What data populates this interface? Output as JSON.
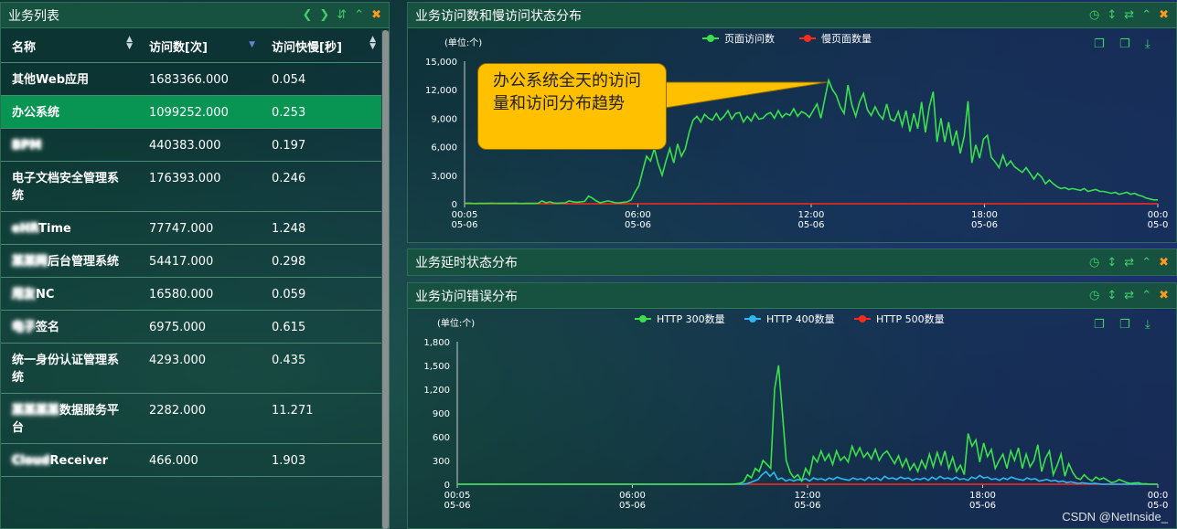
{
  "list_panel": {
    "title": "业务列表",
    "columns": [
      "名称",
      "访问数[次]",
      "访问快慢[秒]"
    ],
    "rows": [
      {
        "name": "其他Web应用",
        "visits": "1683366.000",
        "speed": "0.054",
        "masked": false
      },
      {
        "name": "办公系统",
        "visits": "1099252.000",
        "speed": "0.253",
        "masked": false,
        "selected": true
      },
      {
        "name": "BPM",
        "visits": "440383.000",
        "speed": "0.197",
        "masked": true
      },
      {
        "name": "电子文档安全管理系统",
        "visits": "176393.000",
        "speed": "0.246",
        "masked": false
      },
      {
        "name": "Time",
        "visits": "77747.000",
        "speed": "1.248",
        "masked": false,
        "prefix_masked": "eHR"
      },
      {
        "name": "后台管理系统",
        "visits": "54417.000",
        "speed": "0.298",
        "masked": false,
        "prefix_masked": "某某网"
      },
      {
        "name": "NC",
        "visits": "16580.000",
        "speed": "0.059",
        "masked": false,
        "prefix_masked": "用友"
      },
      {
        "name": "签名",
        "visits": "6975.000",
        "speed": "0.615",
        "masked": false,
        "prefix_masked": "电子"
      },
      {
        "name": "统一身份认证管理系统",
        "visits": "4293.000",
        "speed": "0.435",
        "masked": false
      },
      {
        "name": "数据服务平台",
        "visits": "2282.000",
        "speed": "11.271",
        "masked": false,
        "prefix_masked": "某某某某"
      },
      {
        "name": "Receiver",
        "visits": "466.000",
        "speed": "1.903",
        "masked": false,
        "prefix_masked": "Cloud"
      }
    ]
  },
  "chart1_panel": {
    "title": "业务访问数和慢访问状态分布"
  },
  "delay_panel": {
    "title": "业务延时状态分布"
  },
  "chart2_panel": {
    "title": "业务访问错误分布"
  },
  "callout": {
    "text": "办公系统全天的访问量和访问分布趋势"
  },
  "watermark": "CSDN @NetInside_",
  "icons": {
    "toolbar": [
      "clock-icon",
      "vertical-arrows-icon",
      "refresh-icon",
      "collapse-icon",
      "close-icon"
    ],
    "list_toolbar": [
      "prev-icon",
      "next-icon",
      "sort-icon",
      "collapse-icon",
      "close-icon"
    ],
    "chart_tools": [
      "zoom-icon",
      "zoom-reset-icon",
      "download-icon"
    ]
  },
  "colors": {
    "green": "#39e24b",
    "red": "#ff2a1a",
    "blue": "#2fb8f0",
    "selected_row": "#089553",
    "callout": "#ffc000"
  },
  "chart_data": [
    {
      "type": "line",
      "unit": "(单位:个)",
      "x_ticks": [
        [
          "00:05",
          "05-06"
        ],
        [
          "06:00",
          "05-06"
        ],
        [
          "12:00",
          "05-06"
        ],
        [
          "18:00",
          "05-06"
        ],
        [
          "00:0",
          "05-0"
        ]
      ],
      "ylim": [
        0,
        15000
      ],
      "y_ticks": [
        "15,000",
        "12,000",
        "9,000",
        "6,000",
        "3,000",
        "0"
      ],
      "series": [
        {
          "name": "页面访问数",
          "color": "#39e24b",
          "values": [
            50,
            60,
            40,
            30,
            50,
            40,
            40,
            60,
            50,
            40,
            50,
            40,
            40,
            60,
            40,
            30,
            40,
            50,
            40,
            60,
            300,
            100,
            200,
            80,
            60,
            80,
            100,
            300,
            200,
            150,
            200,
            250,
            800,
            600,
            300,
            100,
            200,
            300,
            200,
            100,
            100,
            150,
            200,
            400,
            1200,
            1900,
            3500,
            5000,
            4500,
            5800,
            4200,
            3000,
            4500,
            5800,
            4300,
            6300,
            5000,
            5800,
            7500,
            8800,
            9200,
            8600,
            9400,
            9000,
            8800,
            9500,
            8800,
            9200,
            9800,
            8900,
            9500,
            9600,
            8600,
            9200,
            8700,
            9500,
            8900,
            9000,
            9400,
            9600,
            9000,
            9800,
            9100,
            9500,
            9300,
            10000,
            9200,
            9700,
            9500,
            9100,
            9800,
            10500,
            9000,
            11000,
            13000,
            12000,
            11400,
            10200,
            9500,
            12500,
            10400,
            9200,
            10700,
            11600,
            9900,
            9300,
            10200,
            9400,
            8900,
            10500,
            8900,
            8700,
            9700,
            8200,
            9800,
            7600,
            9500,
            7900,
            10700,
            7500,
            10200,
            11800,
            6500,
            9000,
            6500,
            8600,
            6100,
            7700,
            5300,
            7100,
            10800,
            4300,
            6200,
            4800,
            6800,
            7200,
            4900,
            4400,
            3800,
            5100,
            4000,
            4500,
            3900,
            3600,
            3300,
            3800,
            3200,
            2600,
            3200,
            2800,
            2100,
            2500,
            2100,
            1800,
            1600,
            1700,
            1500,
            1600,
            1500,
            1400,
            1600,
            1300,
            1400,
            1500,
            1300,
            1300,
            1200,
            1100,
            1200,
            1000,
            1100,
            1200,
            1000,
            1100,
            900,
            800,
            600,
            500,
            400,
            400
          ]
        },
        {
          "name": "慢页面数量",
          "color": "#ff2a1a",
          "values": [
            0,
            0,
            0,
            0,
            0,
            0,
            0,
            0,
            0,
            0,
            0,
            0,
            0,
            0,
            0,
            0,
            0,
            0,
            0,
            0,
            0,
            0,
            0,
            0,
            0,
            0,
            0,
            0,
            0,
            0,
            0,
            0,
            0,
            0,
            0,
            0,
            0,
            0,
            0,
            0,
            0,
            0,
            0,
            0,
            0,
            0,
            0,
            0,
            0,
            0,
            0,
            0,
            0,
            0,
            0,
            0,
            0,
            0,
            0,
            0,
            0,
            0,
            0,
            0,
            0,
            0,
            0,
            0,
            0,
            0,
            0,
            0,
            0,
            0,
            0,
            0,
            0,
            0,
            0,
            0,
            0,
            0,
            0,
            0,
            0,
            0,
            0,
            0,
            0,
            0,
            0,
            0,
            0,
            0,
            0,
            0,
            0,
            0,
            0,
            0,
            0,
            0,
            0,
            0,
            0,
            0,
            0,
            0,
            0,
            0,
            0,
            0,
            0,
            0,
            0,
            0,
            0,
            0,
            0,
            0,
            0,
            0,
            0,
            0,
            0,
            0,
            0,
            0,
            0,
            0,
            0,
            0,
            0,
            0,
            0,
            0,
            0,
            0,
            0,
            0,
            0,
            0,
            0,
            0,
            0,
            0,
            0,
            0,
            0,
            0,
            0,
            0,
            0,
            0,
            0,
            0,
            0,
            0,
            0,
            0,
            0,
            0,
            0,
            0,
            0,
            0,
            0,
            0,
            0,
            0,
            0,
            0,
            0,
            0,
            0,
            0,
            0,
            0,
            0,
            0
          ]
        }
      ]
    },
    {
      "type": "line",
      "unit": "(单位:个)",
      "x_ticks": [
        [
          "00:05",
          "05-06"
        ],
        [
          "06:00",
          "05-06"
        ],
        [
          "12:00",
          "05-06"
        ],
        [
          "18:00",
          "05-06"
        ],
        [
          "00:0",
          "05-0"
        ]
      ],
      "ylim": [
        0,
        1800
      ],
      "y_ticks": [
        "1,800",
        "1,500",
        "1,200",
        "900",
        "600",
        "300",
        "0"
      ],
      "series": [
        {
          "name": "HTTP 300数量",
          "color": "#39e24b",
          "values": [
            0,
            0,
            0,
            0,
            0,
            0,
            0,
            0,
            0,
            0,
            0,
            0,
            0,
            0,
            0,
            0,
            0,
            0,
            0,
            0,
            0,
            0,
            0,
            0,
            0,
            0,
            0,
            0,
            0,
            0,
            0,
            0,
            0,
            0,
            0,
            0,
            0,
            0,
            0,
            0,
            0,
            0,
            0,
            0,
            0,
            0,
            0,
            0,
            0,
            0,
            0,
            0,
            0,
            0,
            0,
            0,
            0,
            0,
            0,
            0,
            0,
            0,
            0,
            0,
            0,
            0,
            0,
            0,
            0,
            0,
            0,
            0,
            5,
            10,
            30,
            120,
            80,
            200,
            160,
            300,
            250,
            200,
            1200,
            1500,
            900,
            300,
            150,
            80,
            120,
            40,
            200,
            120,
            350,
            280,
            420,
            300,
            380,
            250,
            420,
            300,
            350,
            280,
            480,
            360,
            460,
            340,
            400,
            320,
            440,
            300,
            380,
            420,
            340,
            260,
            360,
            220,
            320,
            180,
            260,
            160,
            300,
            200,
            380,
            220,
            400,
            250,
            420,
            200,
            340,
            160,
            240,
            120,
            640,
            480,
            560,
            280,
            520,
            350,
            440,
            200,
            300,
            380,
            200,
            420,
            300,
            460,
            200,
            380,
            220,
            300,
            500,
            160,
            330,
            420,
            120,
            240,
            380,
            100,
            260,
            150,
            80,
            60,
            120,
            70,
            40,
            90,
            60,
            80,
            50,
            20,
            30,
            60,
            40,
            20,
            10,
            15,
            20,
            5,
            5,
            0,
            0,
            0
          ]
        },
        {
          "name": "HTTP 400数量",
          "color": "#2fb8f0",
          "values": [
            0,
            0,
            0,
            0,
            0,
            0,
            0,
            0,
            0,
            0,
            0,
            0,
            0,
            0,
            0,
            0,
            0,
            0,
            0,
            0,
            0,
            0,
            0,
            0,
            0,
            0,
            0,
            0,
            0,
            0,
            0,
            0,
            0,
            0,
            0,
            0,
            0,
            0,
            0,
            0,
            0,
            0,
            0,
            0,
            0,
            0,
            0,
            0,
            0,
            0,
            0,
            0,
            0,
            0,
            0,
            0,
            0,
            0,
            0,
            0,
            0,
            0,
            0,
            0,
            0,
            0,
            0,
            0,
            0,
            0,
            0,
            0,
            0,
            5,
            20,
            40,
            60,
            120,
            160,
            100,
            150,
            60,
            80,
            40,
            60,
            40,
            60,
            50,
            70,
            40,
            80,
            60,
            70,
            50,
            80,
            60,
            90,
            70,
            60,
            50,
            80,
            60,
            70,
            50,
            90,
            60,
            80,
            50,
            100,
            70,
            80,
            60,
            90,
            70,
            80,
            50,
            70,
            60,
            80,
            50,
            90,
            60,
            100,
            70,
            80,
            60,
            90,
            60,
            70,
            50,
            90,
            70,
            110,
            80,
            90,
            60,
            70,
            50,
            80,
            60,
            90,
            70,
            60,
            50,
            80,
            60,
            70,
            40,
            50,
            60,
            40,
            50,
            30,
            40,
            20,
            30,
            20,
            10,
            20,
            10,
            5,
            10,
            5,
            0,
            0,
            0,
            0,
            0,
            0,
            0,
            0,
            0,
            0,
            0,
            0,
            0,
            0,
            0
          ]
        },
        {
          "name": "HTTP 500数量",
          "color": "#ff2a1a",
          "values": [
            0,
            0,
            0,
            0,
            0,
            0,
            0,
            0,
            0,
            0,
            0,
            0,
            0,
            0,
            0,
            0,
            0,
            0,
            0,
            0,
            0,
            0,
            0,
            0,
            0,
            0,
            0,
            0,
            0,
            0,
            0,
            0,
            0,
            0,
            0,
            0,
            0,
            0,
            0,
            0,
            0,
            0,
            0,
            0,
            0,
            0,
            0,
            0,
            0,
            0,
            0,
            0,
            0,
            0,
            0,
            0,
            0,
            0,
            0,
            0,
            0,
            0,
            0,
            0,
            0,
            0,
            0,
            0,
            0,
            0,
            0,
            0,
            0,
            0,
            0,
            0,
            0,
            0,
            0,
            0,
            0,
            0,
            0,
            0,
            0,
            0,
            0,
            0,
            0,
            0,
            0,
            0,
            0,
            0,
            0,
            0,
            0,
            0,
            0,
            0,
            0,
            0,
            0,
            0,
            0,
            0,
            0,
            0,
            0,
            0,
            0,
            0,
            0,
            0,
            0,
            0,
            0,
            0,
            0,
            0,
            0,
            0,
            0,
            0,
            0,
            0,
            0,
            0,
            0,
            0,
            0,
            0,
            0,
            0,
            0,
            0,
            0,
            0,
            0,
            0,
            0,
            0,
            0,
            0,
            0,
            0,
            0,
            0,
            0,
            0,
            0,
            0,
            0,
            0,
            0,
            0,
            0,
            0,
            0,
            0,
            0,
            0,
            0,
            0,
            0,
            0,
            0,
            0,
            0,
            0,
            0,
            0,
            0,
            0,
            0,
            0,
            0,
            0,
            0,
            0
          ]
        }
      ]
    }
  ]
}
